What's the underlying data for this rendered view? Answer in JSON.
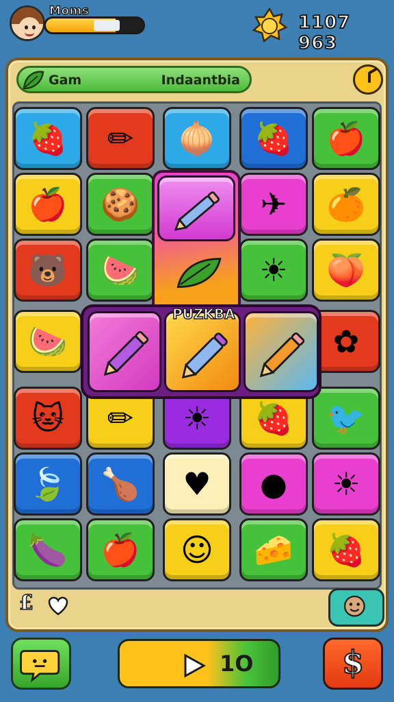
{
  "hud": {
    "player_name": "Moms",
    "progress_fraction": 0.72,
    "score": "1107 963"
  },
  "level": {
    "left_label": "Gam",
    "right_label": "Indaantbia"
  },
  "combo": {
    "label": "PUZKBA"
  },
  "colors": {
    "background": "#3c7fb3",
    "panel": "#ead38a",
    "accent_gold": "#ffc21a",
    "accent_green": "#45c23a"
  },
  "board": {
    "rows": [
      [
        {
          "color": "c-blue",
          "icon": "raspberry-icon",
          "glyph": "🍓"
        },
        {
          "color": "c-red",
          "icon": "pen-icon",
          "glyph": "✏"
        },
        {
          "color": "c-blue",
          "icon": "onion-icon",
          "glyph": "🧅"
        },
        {
          "color": "c-dblue",
          "icon": "strawberry-icon",
          "glyph": "🍓"
        },
        {
          "color": "c-green",
          "icon": "apple-icon",
          "glyph": "🍎"
        }
      ],
      [
        {
          "color": "c-yellow",
          "icon": "apple-icon",
          "glyph": "🍎"
        },
        {
          "color": "c-green",
          "icon": "cookie-icon",
          "glyph": "🍪"
        },
        null,
        {
          "color": "c-pink",
          "icon": "paper-plane-icon",
          "glyph": "✈"
        },
        {
          "color": "c-yellow",
          "icon": "orange-icon",
          "glyph": "🍊"
        }
      ],
      [
        {
          "color": "c-red",
          "icon": "bear-icon",
          "glyph": "🐻"
        },
        {
          "color": "c-green",
          "icon": "watermelon-icon",
          "glyph": "🍉"
        },
        null,
        {
          "color": "c-green",
          "icon": "sun-icon",
          "glyph": "☀"
        },
        {
          "color": "c-yellow",
          "icon": "peach-icon",
          "glyph": "🍑"
        }
      ],
      [
        {
          "color": "c-yellow",
          "icon": "watermelon-icon",
          "glyph": "🍉"
        },
        null,
        null,
        null,
        {
          "color": "c-red",
          "icon": "flower-icon",
          "glyph": "✿"
        }
      ],
      [
        {
          "color": "c-red",
          "icon": "cat-icon",
          "glyph": "🐱"
        },
        {
          "color": "c-yellow",
          "icon": "pencil-icon",
          "glyph": "✏"
        },
        {
          "color": "c-purple",
          "icon": "sun-icon",
          "glyph": "☀"
        },
        {
          "color": "c-yellow",
          "icon": "strawberry-icon",
          "glyph": "🍓"
        },
        {
          "color": "c-green",
          "icon": "bird-icon",
          "glyph": "🐦"
        }
      ],
      [
        {
          "color": "c-dblue",
          "icon": "leaf-icon",
          "glyph": "🍃"
        },
        {
          "color": "c-dblue",
          "icon": "chicken-icon",
          "glyph": "🍗"
        },
        {
          "color": "c-cream",
          "icon": "heart-icon",
          "glyph": "♥"
        },
        {
          "color": "c-pink",
          "icon": "blueberry-icon",
          "glyph": "●"
        },
        {
          "color": "c-pink",
          "icon": "sun-icon",
          "glyph": "☀"
        }
      ],
      [
        {
          "color": "c-green",
          "icon": "eggplant-icon",
          "glyph": "🍆"
        },
        {
          "color": "c-green",
          "icon": "apple-icon",
          "glyph": "🍎"
        },
        {
          "color": "c-yellow",
          "icon": "green-blob-icon",
          "glyph": "☺"
        },
        {
          "color": "c-green",
          "icon": "cheese-icon",
          "glyph": "🧀"
        },
        {
          "color": "c-yellow",
          "icon": "strawberry-icon",
          "glyph": "🍓"
        }
      ]
    ]
  },
  "footer": {
    "currency_symbol": "£",
    "play_count": "1O",
    "shop_symbol": "$"
  }
}
